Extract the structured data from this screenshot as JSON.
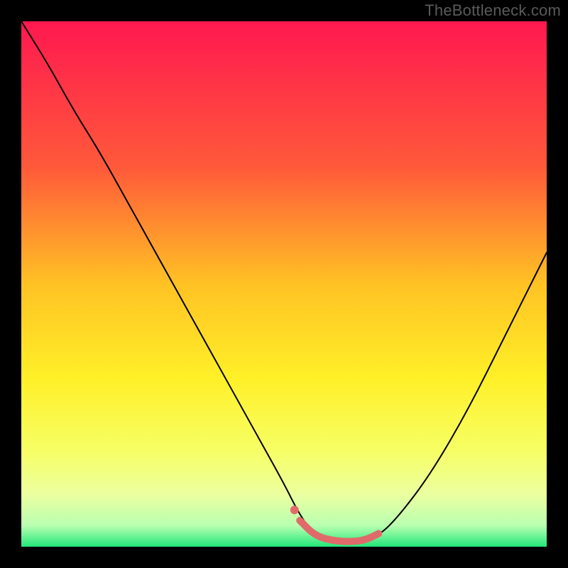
{
  "watermark": "TheBottleneck.com",
  "chart_data": {
    "type": "line",
    "title": "",
    "xlabel": "",
    "ylabel": "",
    "xlim": [
      0,
      100
    ],
    "ylim": [
      0,
      100
    ],
    "grid": false,
    "legend": false,
    "gradient_stops": [
      {
        "offset": 0,
        "color": "#ff1850"
      },
      {
        "offset": 0.28,
        "color": "#ff5a3a"
      },
      {
        "offset": 0.5,
        "color": "#ffc224"
      },
      {
        "offset": 0.68,
        "color": "#fff028"
      },
      {
        "offset": 0.82,
        "color": "#f6ff66"
      },
      {
        "offset": 0.9,
        "color": "#ecffa0"
      },
      {
        "offset": 0.96,
        "color": "#b8ffb0"
      },
      {
        "offset": 1.0,
        "color": "#22e87a"
      }
    ],
    "series": [
      {
        "name": "bottleneck-curve",
        "stroke": "#000000",
        "stroke_width": 2,
        "x": [
          0,
          5,
          10,
          15,
          20,
          25,
          30,
          35,
          40,
          45,
          50,
          53,
          56,
          60,
          64,
          68,
          72,
          78,
          85,
          92,
          100
        ],
        "y": [
          100,
          92,
          83,
          75,
          66,
          57,
          48,
          39,
          30,
          21,
          12,
          6,
          2,
          1,
          1,
          2,
          6,
          14,
          26,
          40,
          56
        ]
      },
      {
        "name": "highlight-segment",
        "stroke": "#e06a6a",
        "stroke_width": 10,
        "x": [
          53,
          56,
          60,
          64,
          66,
          68
        ],
        "y": [
          5,
          2,
          1,
          1,
          1.5,
          2.5
        ]
      },
      {
        "name": "highlight-dot",
        "type": "scatter",
        "fill": "#e06a6a",
        "x": [
          52
        ],
        "y": [
          7
        ]
      }
    ]
  }
}
